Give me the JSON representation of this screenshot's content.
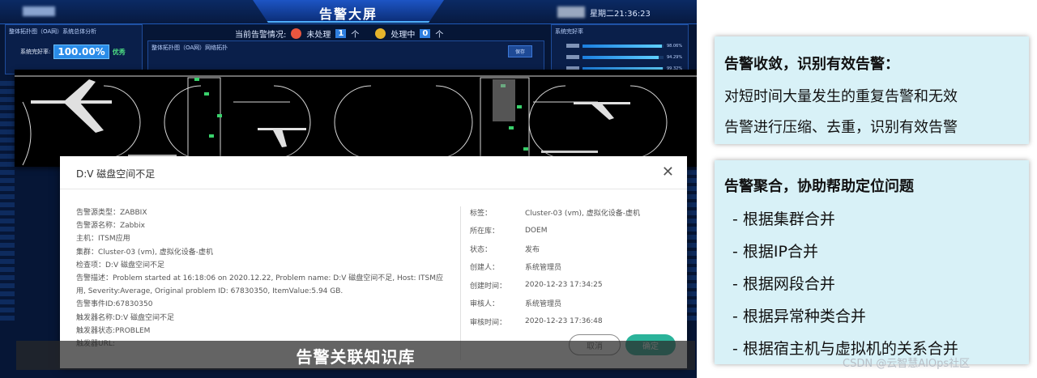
{
  "dashboard": {
    "title": "告警大屏",
    "datetime": "星期二21:36:23",
    "status": {
      "label": "当前告警情况:",
      "unhandled_label": "未处理",
      "unhandled_count": "1",
      "unhandled_unit": "个",
      "handling_label": "处理中",
      "handling_count": "0",
      "handling_unit": "个"
    },
    "left_panel": {
      "title": "整体拓扑图（OA网）系统总体分析",
      "rate_label": "系统完好率:",
      "rate_value": "100.00%",
      "rate_tag": "优秀"
    },
    "topo_panel": {
      "title": "整体拓扑图（OA网）网络拓扑",
      "save_label": "保存"
    },
    "right_panel": {
      "title": "系统完好率",
      "bars": [
        {
          "value": "98.06%",
          "fill": 0.98
        },
        {
          "value": "94.29%",
          "fill": 0.94
        },
        {
          "value": "99.32%",
          "fill": 0.99
        }
      ]
    }
  },
  "modal": {
    "title": "D:V 磁盘空间不足",
    "close_icon": "close-icon",
    "details": [
      "告警源类型：ZABBIX",
      "告警源名称：Zabbix",
      "主机：ITSM应用",
      "集群：Cluster-03 (vm), 虚拟化设备-虚机",
      "检查项：D:V 磁盘空间不足",
      "告警描述：Problem started at 16:18:06 on 2020.12.22, Problem name: D:V 磁盘空间不足, Host: ITSM应",
      "用, Severity:Average, Original problem ID: 67830350, ItemValue:5.94 GB.",
      "告警事件ID:67830350",
      "触发器名称:D:V 磁盘空间不足",
      "触发器状态:PROBLEM",
      "触发器URL:"
    ],
    "meta": [
      {
        "key": "标签：",
        "value": "Cluster-03 (vm), 虚拟化设备-虚机"
      },
      {
        "key": "所在库：",
        "value": "DOEM"
      },
      {
        "key": "状态：",
        "value": "发布"
      },
      {
        "key": "创建人：",
        "value": "系统管理员"
      },
      {
        "key": "创建时间：",
        "value": "2020-12-23 17:34:25"
      },
      {
        "key": "审核人：",
        "value": "系统管理员"
      },
      {
        "key": "审核时间：",
        "value": "2020-12-23 17:36:48"
      }
    ],
    "cancel_label": "取消",
    "ok_label": "确定"
  },
  "caption": "告警关联知识库",
  "note1": {
    "title": "告警收敛，识别有效告警：",
    "lines": [
      "对短时间大量发生的重复告警和无效",
      "告警进行压缩、去重，识别有效告警"
    ]
  },
  "note2": {
    "title": "告警聚合，协助帮助定位问题",
    "items": [
      "- 根据集群合并",
      "- 根据IP合并",
      "- 根据网段合并",
      "- 根据异常种类合并",
      "- 根据宿主机与虚拟机的关系合并"
    ]
  },
  "watermark": "CSDN @云智慧AIOps社区",
  "colors": {
    "accent": "#2bb39a",
    "dash_bg": "#061636",
    "note_bg": "#d8f1f7",
    "alert_red": "#e8563f"
  }
}
